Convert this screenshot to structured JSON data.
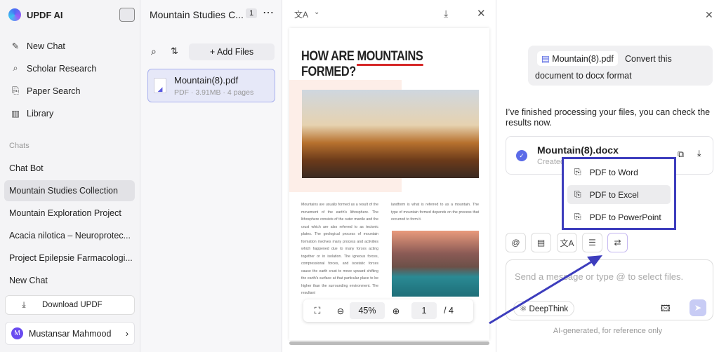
{
  "sidebar": {
    "app_name": "UPDF AI",
    "nav": [
      {
        "label": "New Chat",
        "icon": "edit-icon"
      },
      {
        "label": "Scholar Research",
        "icon": "telescope-icon"
      },
      {
        "label": "Paper Search",
        "icon": "search-doc-icon"
      },
      {
        "label": "Library",
        "icon": "library-icon"
      }
    ],
    "chats_label": "Chats",
    "chats": [
      "Chat Bot",
      "Mountain Studies Collection",
      "Mountain Exploration Project",
      "Acacia nilotica – Neuroprotec...",
      "Project Epilepsie Farmacologi...",
      "New Chat"
    ],
    "active_chat": 1,
    "download_label": "Download UPDF",
    "user": {
      "initial": "M",
      "name": "Mustansar Mahmood"
    }
  },
  "files": {
    "title": "Mountain Studies C...",
    "count": "1",
    "add_files": "Add Files",
    "items": [
      {
        "name": "Mountain(8).pdf",
        "meta": "PDF · 3.91MB · 4 pages"
      }
    ]
  },
  "viewer": {
    "heading_pre": "HOW ARE ",
    "heading_mark": "MOUNTAINS",
    "heading_post": " FORMED?",
    "col_left": "Mountains are usually formed as a result of the movement of the earth's lithosphere. The lithosphere consists of the outer mantle and the crust which are also referred to as tectonic plates. The geological process of mountain formation involves many process and activities which happened due to many forces acting together or in isolation. The igneous forces, compressional forces, and isostatic forces cause the earth crust to move upward shifting the earth's surface at that particular place to be higher than the surrounding environment. The resultant",
    "col_right": "landform is what is referred to as a mountain. The type of mountain formed depends on the process that occurred to form it.",
    "zoom": "45%",
    "page": "1",
    "total_pages": "/ 4",
    "accent": "#d62828"
  },
  "chat": {
    "user_file": "Mountain(8).pdf",
    "user_msg_1": "Convert this",
    "user_msg_2": "document to docx format",
    "reply": "I’ve finished processing your files, you can check the results now.",
    "result_name": "Mountain(8).docx",
    "result_sub": "Created",
    "menu": [
      "PDF to Word",
      "PDF to Excel",
      "PDF to PowerPoint"
    ],
    "menu_hover": 1,
    "placeholder": "Send a message or type @ to select files.",
    "deepthink": "DeepThink",
    "footer": "AI-generated, for reference only",
    "highlight_color": "#3d3dbd"
  }
}
